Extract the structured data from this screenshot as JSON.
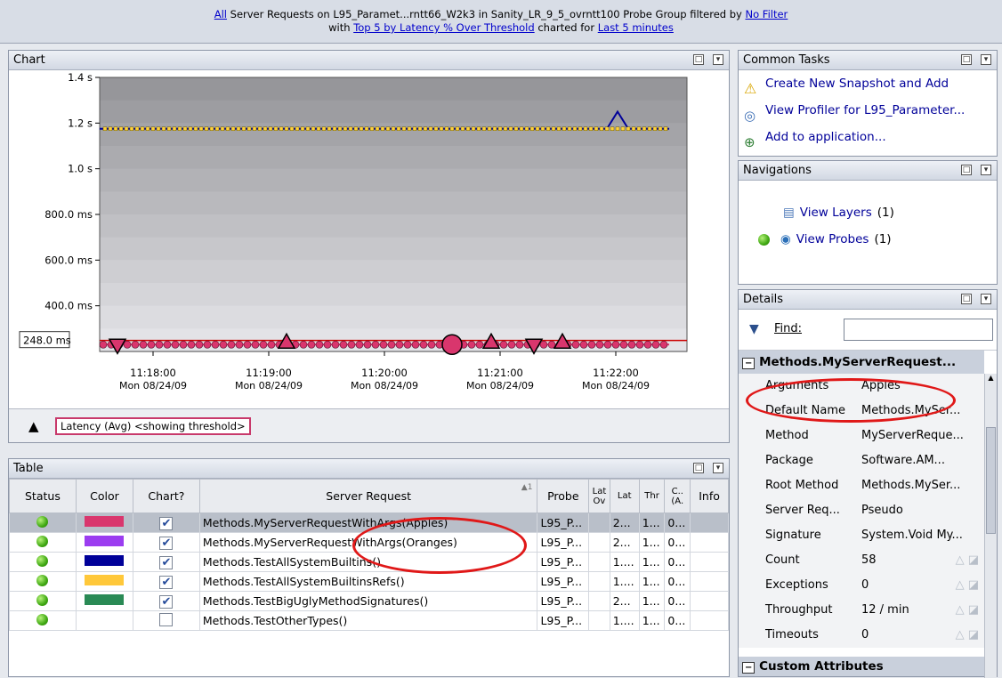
{
  "header": {
    "link_all": "All",
    "line1_text": " Server Requests on L95_Paramet...rntt66_W2k3 in Sanity_LR_9_5_ovrntt100 Probe Group filtered by ",
    "link_filter": "No Filter",
    "line2_prefix": "with ",
    "link_top5": "Top 5 by Latency % Over Threshold",
    "line2_mid": " charted for ",
    "link_period": "Last 5 minutes"
  },
  "chart_panel": {
    "title": "Chart",
    "legend_label": "Latency (Avg) <showing threshold>"
  },
  "chart_data": {
    "type": "line",
    "ylabel": "Latency (Avg)",
    "y_ticks": [
      "1.4 s",
      "1.2 s",
      "1.0 s",
      "800.0 ms",
      "600.0 ms",
      "400.0 ms"
    ],
    "y_tick_values": [
      1400,
      1200,
      1000,
      800,
      600,
      400
    ],
    "ylim": [
      200,
      1400
    ],
    "x_ticks": [
      "11:18:00",
      "11:19:00",
      "11:20:00",
      "11:21:00",
      "11:22:00"
    ],
    "x_tick_dates": [
      "Mon 08/24/09",
      "Mon 08/24/09",
      "Mon 08/24/09",
      "Mon 08/24/09",
      "Mon 08/24/09"
    ],
    "threshold_label": "248.0 ms",
    "threshold_value": 248,
    "series": [
      {
        "name": "Methods.MyServerRequestWithArgs(Apples)",
        "color": "#d9366d",
        "level_ms": 230
      },
      {
        "name": "Methods.TestAllSystemBuiltinsRefs()",
        "color": "#ffd23a",
        "level_ms": 1175
      },
      {
        "name": "Methods.TestAllSystemBuiltins()",
        "color": "#000099",
        "level_ms": 1175,
        "peak_ms": 1250
      }
    ]
  },
  "table_panel": {
    "title": "Table",
    "columns": [
      "Status",
      "Color",
      "Chart?",
      "Server Request",
      "Probe",
      "Lat Ov",
      "Lat",
      "Thr",
      "C.. (A.",
      "Info"
    ],
    "sort_indicator": "▲1",
    "rows": [
      {
        "request": "Methods.MyServerRequestWithArgs(Apples)",
        "probe": "L95_P...",
        "latov": "",
        "lat": "2...",
        "thr": "1...",
        "c": "0...",
        "color": "#d9366d",
        "checked": "✔"
      },
      {
        "request": "Methods.MyServerRequestWithArgs(Oranges)",
        "probe": "L95_P...",
        "latov": "",
        "lat": "2...",
        "thr": "1...",
        "c": "0...",
        "color": "#9b3df0",
        "checked": "✔"
      },
      {
        "request": "Methods.TestAllSystemBuiltins()",
        "probe": "L95_P...",
        "latov": "",
        "lat": "1....",
        "thr": "1...",
        "c": "0...",
        "color": "#000099",
        "checked": "✔"
      },
      {
        "request": "Methods.TestAllSystemBuiltinsRefs()",
        "probe": "L95_P...",
        "latov": "",
        "lat": "1....",
        "thr": "1...",
        "c": "0...",
        "color": "#ffc83a",
        "checked": "✔"
      },
      {
        "request": "Methods.TestBigUglyMethodSignatures()",
        "probe": "L95_P...",
        "latov": "",
        "lat": "2...",
        "thr": "1...",
        "c": "0...",
        "color": "#2a8a55",
        "checked": "✔"
      },
      {
        "request": "Methods.TestOtherTypes()",
        "probe": "L95_P...",
        "latov": "",
        "lat": "1....",
        "thr": "1...",
        "c": "0...",
        "color": "",
        "checked": ""
      }
    ]
  },
  "common_tasks": {
    "title": "Common Tasks",
    "items": [
      {
        "label": "Create New Snapshot and Add",
        "icon": "warning-icon"
      },
      {
        "label": "View Profiler for L95_Parameter...",
        "icon": "profiler-icon"
      },
      {
        "label": "Add to application...",
        "icon": "add-globe-icon"
      }
    ]
  },
  "navigations": {
    "title": "Navigations",
    "layers_label": "View Layers",
    "layers_count": "(1)",
    "probes_label": "View Probes",
    "probes_count": "(1)"
  },
  "details": {
    "title": "Details",
    "find_label": "Find:",
    "section_title": "Methods.MyServerRequest...",
    "rows": [
      {
        "key": "Arguments",
        "value": "Apples"
      },
      {
        "key": "Default Name",
        "value": "Methods.MySer..."
      },
      {
        "key": "Method",
        "value": "MyServerReque..."
      },
      {
        "key": "Package",
        "value": "Software.AM..."
      },
      {
        "key": "Root Method",
        "value": "Methods.MySer..."
      },
      {
        "key": "Server Req...",
        "value": "Pseudo"
      },
      {
        "key": "Signature",
        "value": "System.Void My..."
      },
      {
        "key": "Count",
        "value": "58"
      },
      {
        "key": "Exceptions",
        "value": "0"
      },
      {
        "key": "Throughput",
        "value": "12 / min"
      },
      {
        "key": "Timeouts",
        "value": "0"
      }
    ],
    "custom_section": "Custom Attributes"
  }
}
